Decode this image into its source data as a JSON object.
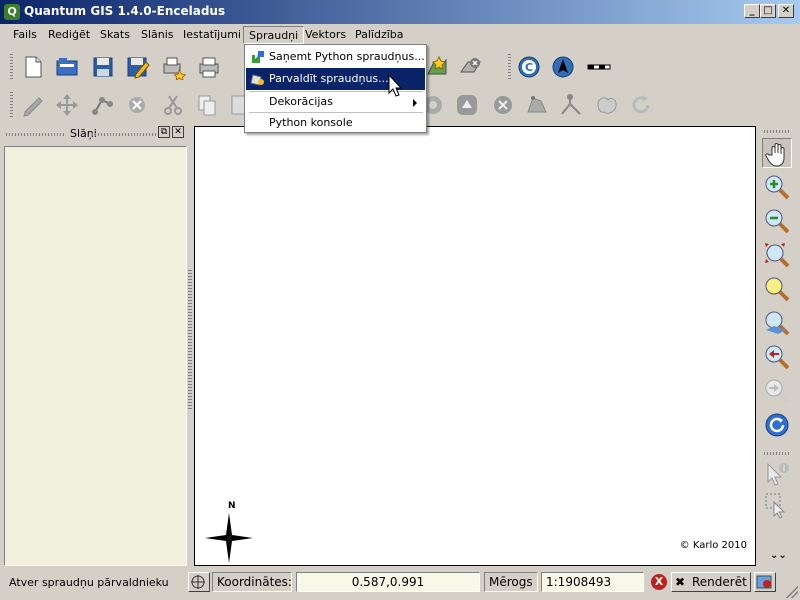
{
  "window": {
    "title": "Quantum GIS 1.4.0-Enceladus",
    "app_icon_letter": "Q",
    "minimize": "_",
    "maximize": "□",
    "close": "✕"
  },
  "menubar": {
    "items": [
      "Fails",
      "Rediģēt",
      "Skats",
      "Slānis",
      "Iestatījumi",
      "Spraudņi",
      "Vektors",
      "Palīdzība"
    ],
    "open_item": "Spraudņi"
  },
  "plugins_menu": {
    "items": [
      {
        "label": "Saņemt Python spraudņus...",
        "icon": "plugin-download-icon"
      },
      {
        "label": "Parvaldīt spraudņus...",
        "icon": "plugin-manage-icon",
        "highlighted": true
      },
      {
        "label": "Dekorācijas",
        "submenu": true
      },
      {
        "label": "Python konsole"
      }
    ]
  },
  "layers_panel": {
    "title": "Slāņi"
  },
  "map": {
    "north_label": "N",
    "copyright": "© Karlo 2010"
  },
  "statusbar": {
    "message": "Atver spraudņu pārvaldnieku",
    "coords_label": "Koordinātes:",
    "coords_value": "0.587,0.991",
    "scale_label": "Mērogs",
    "scale_value": "1:1908493",
    "render_label": "Renderēt"
  },
  "colors": {
    "menu_highlight": "#0a246a",
    "title_gradient_start": "#0a246a",
    "layers_bg": "#f0f0dc",
    "stop_red": "#c0201c"
  }
}
